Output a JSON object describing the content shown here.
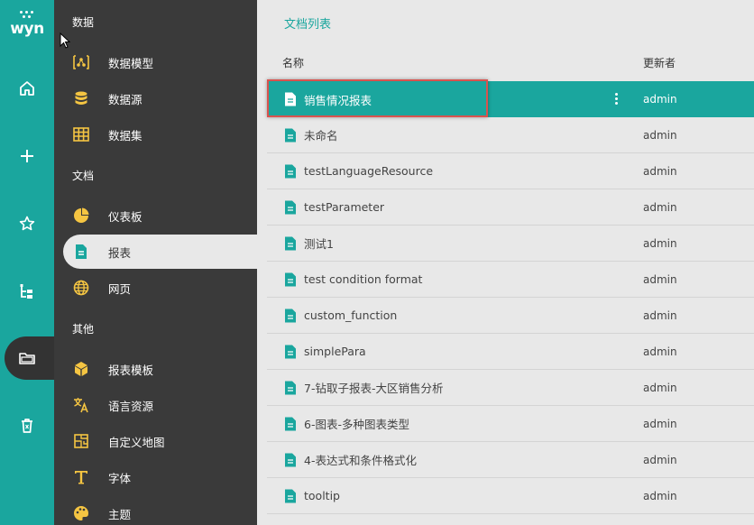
{
  "rail": {
    "logo_text": "wyn",
    "buttons": [
      {
        "name": "home-icon"
      },
      {
        "name": "plus-icon"
      },
      {
        "name": "star-icon"
      },
      {
        "name": "tree-icon"
      },
      {
        "name": "folder-icon"
      },
      {
        "name": "trash-icon"
      }
    ]
  },
  "menu": {
    "sections": [
      {
        "title": "数据",
        "items": [
          {
            "label": "数据模型",
            "icon": "data-model-icon"
          },
          {
            "label": "数据源",
            "icon": "database-icon"
          },
          {
            "label": "数据集",
            "icon": "dataset-grid-icon"
          }
        ]
      },
      {
        "title": "文档",
        "items": [
          {
            "label": "仪表板",
            "icon": "pie-chart-icon"
          },
          {
            "label": "报表",
            "icon": "report-doc-icon",
            "active": true
          },
          {
            "label": "网页",
            "icon": "globe-icon"
          }
        ]
      },
      {
        "title": "其他",
        "items": [
          {
            "label": "报表模板",
            "icon": "cube-icon"
          },
          {
            "label": "语言资源",
            "icon": "translate-icon"
          },
          {
            "label": "自定义地图",
            "icon": "map-icon"
          },
          {
            "label": "字体",
            "icon": "font-icon"
          },
          {
            "label": "主题",
            "icon": "palette-icon"
          }
        ]
      }
    ]
  },
  "content": {
    "title": "文档列表",
    "columns": {
      "name": "名称",
      "updater": "更新者"
    },
    "rows": [
      {
        "name": "销售情况报表",
        "updater": "admin",
        "selected": true
      },
      {
        "name": "未命名",
        "updater": "admin"
      },
      {
        "name": "testLanguageResource",
        "updater": "admin"
      },
      {
        "name": "testParameter",
        "updater": "admin"
      },
      {
        "name": "测试1",
        "updater": "admin"
      },
      {
        "name": "test condition format",
        "updater": "admin"
      },
      {
        "name": "custom_function",
        "updater": "admin"
      },
      {
        "name": "simplePara",
        "updater": "admin"
      },
      {
        "name": "7-钻取子报表-大区销售分析",
        "updater": "admin"
      },
      {
        "name": "6-图表-多种图表类型",
        "updater": "admin"
      },
      {
        "name": "4-表达式和条件格式化",
        "updater": "admin"
      },
      {
        "name": "tooltip",
        "updater": "admin"
      }
    ]
  },
  "colors": {
    "accent": "#1aa69e",
    "menu_bg": "#3a3a3a",
    "icon_yellow": "#f5c542",
    "highlight": "#d9534f"
  }
}
